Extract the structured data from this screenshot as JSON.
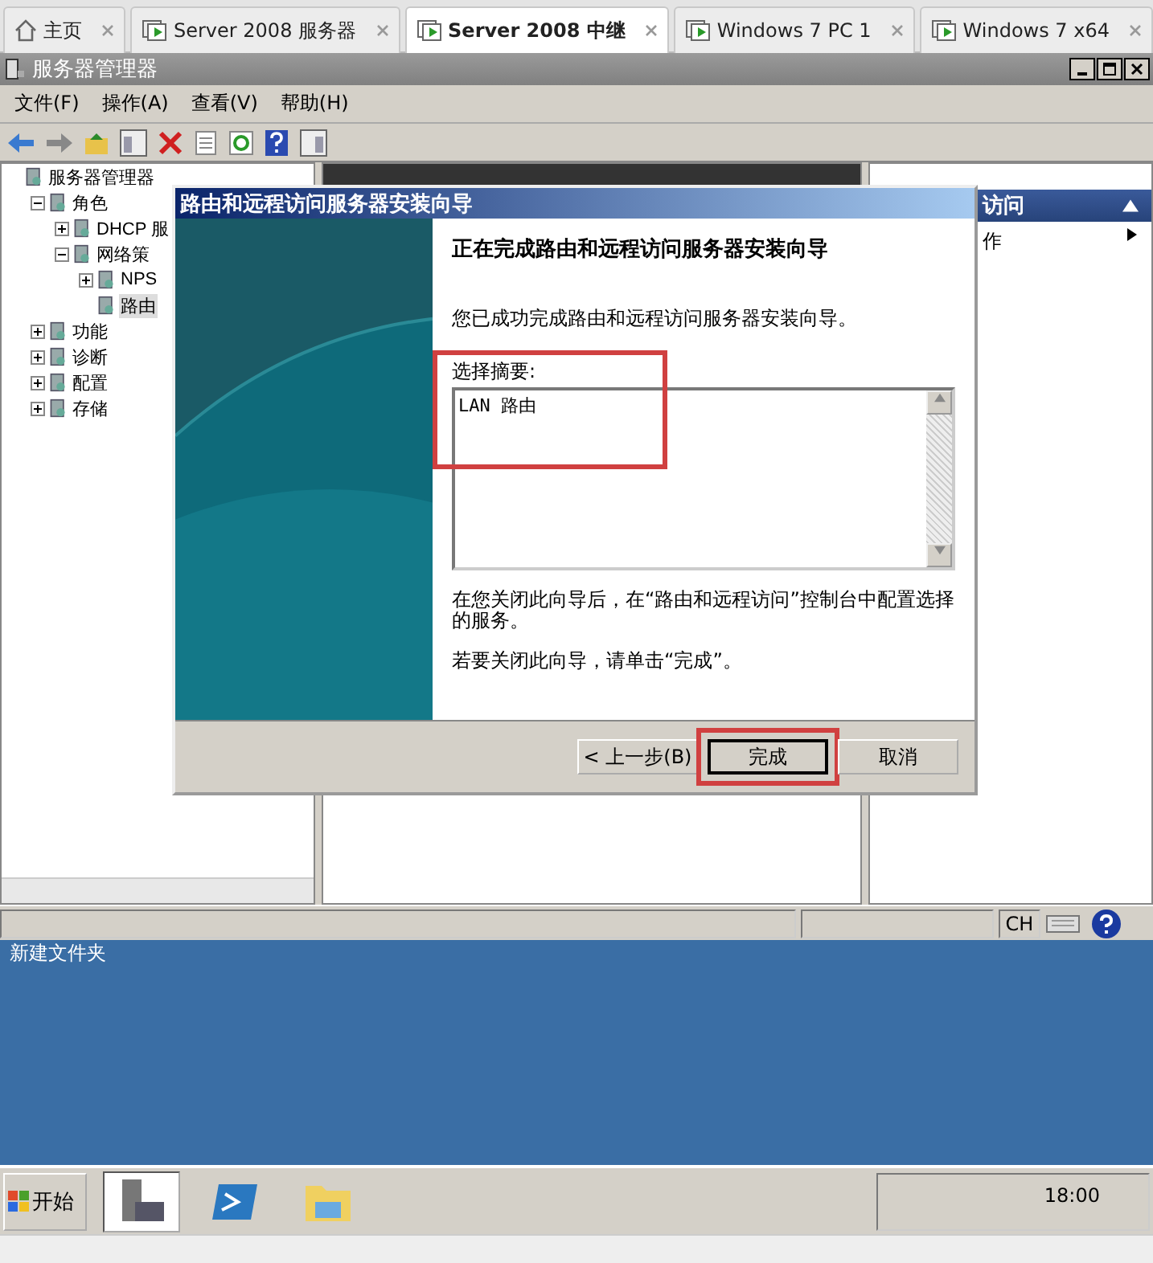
{
  "tabs": [
    {
      "kind": "home",
      "label": "主页",
      "selected": false
    },
    {
      "kind": "vm",
      "label": "Server 2008 服务器",
      "selected": false
    },
    {
      "kind": "vm",
      "label": "Server 2008  中继",
      "selected": true
    },
    {
      "kind": "vm",
      "label": "Windows 7 PC 1",
      "selected": false
    },
    {
      "kind": "vm",
      "label": "Windows 7 x64",
      "selected": false
    }
  ],
  "window": {
    "title": "服务器管理器"
  },
  "menu": [
    "文件(F)",
    "操作(A)",
    "查看(V)",
    "帮助(H)"
  ],
  "tree": {
    "label": "服务器管理器",
    "children": [
      {
        "label": "角色",
        "expanded": true,
        "children": [
          {
            "label": "DHCP 服",
            "expanded": false
          },
          {
            "label": "网络策",
            "expanded": true,
            "children": [
              {
                "label": "NPS",
                "expanded": false
              },
              {
                "label": "路由",
                "selected": true
              }
            ]
          }
        ]
      },
      {
        "label": "功能",
        "expanded": false
      },
      {
        "label": "诊断",
        "expanded": false
      },
      {
        "label": "配置",
        "expanded": false
      },
      {
        "label": "存储",
        "expanded": false
      }
    ]
  },
  "actions": {
    "header": "访问",
    "item": "作"
  },
  "dialog": {
    "title": "路由和远程访问服务器安装向导",
    "heading": "正在完成路由和远程访问服务器安装向导",
    "intro": "您已成功完成路由和远程访问服务器安装向导。",
    "summary_label": "选择摘要:",
    "summary_value": "LAN 路由",
    "summary_highlighted": true,
    "note": "在您关闭此向导后，在“路由和远程访问”控制台中配置选择的服务。",
    "close_hint": "若要关闭此向导，请单击“完成”。",
    "buttons": [
      {
        "label": "< 上一步(B)",
        "default": false,
        "highlighted": false
      },
      {
        "label": "完成",
        "default": true,
        "highlighted": true
      },
      {
        "label": "取消",
        "default": false,
        "highlighted": false
      }
    ]
  },
  "status_bar": {
    "language": "CH"
  },
  "desktop": {
    "icon_label": "新建文件夹"
  },
  "taskbar": {
    "start": "开始",
    "time": "18:00"
  }
}
